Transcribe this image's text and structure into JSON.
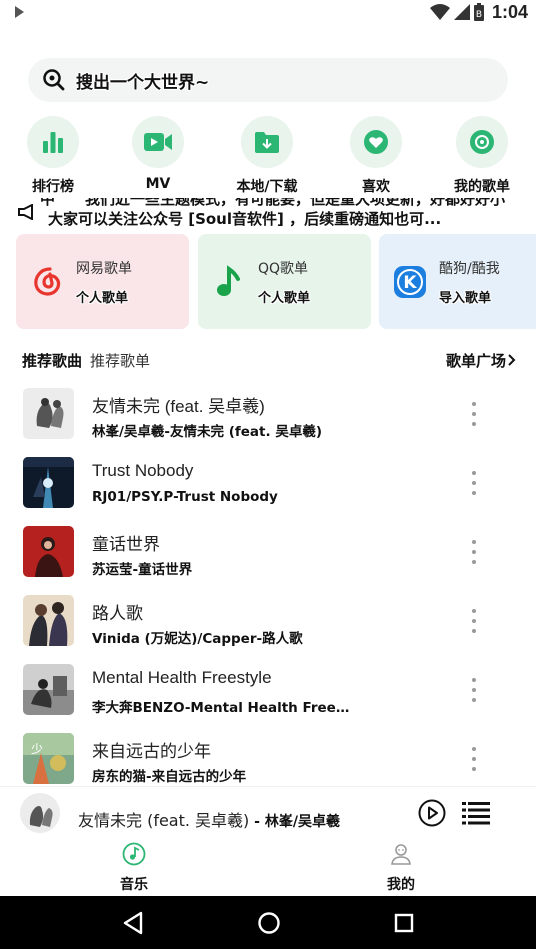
{
  "status_bar": {
    "time": "1:04"
  },
  "search": {
    "placeholder": "搜出一个大世界~"
  },
  "quick_nav": [
    {
      "label": "排行榜",
      "icon": "bar-chart-icon"
    },
    {
      "label": "MV",
      "icon": "video-icon"
    },
    {
      "label": "本地/下载",
      "icon": "download-folder-icon"
    },
    {
      "label": "喜欢",
      "icon": "heart-icon"
    },
    {
      "label": "我的歌单",
      "icon": "playlist-disc-icon"
    }
  ],
  "notice": {
    "line1": "中　　我们近一些主题模式，有可能要，但是重大项更新，好都好好小",
    "line2": "大家可以关注公众号 [Soul音软件] ，后续重磅通知也可..."
  },
  "playlist_cards": [
    {
      "title": "网易歌单",
      "subtitle": "个人歌单",
      "icon": "netease-music-icon",
      "bg": "#fae6e8"
    },
    {
      "title": "QQ歌单",
      "subtitle": "个人歌单",
      "icon": "qq-music-icon",
      "bg": "#e6f4ea"
    },
    {
      "title": "酷狗/酷我",
      "subtitle": "导入歌单",
      "icon": "kugou-icon",
      "bg": "#e6f0fa"
    }
  ],
  "section": {
    "title": "推荐歌曲",
    "subtitle": "推荐歌单",
    "more": "歌单广场"
  },
  "songs": [
    {
      "title": "友情未完 (feat. 吴卓羲)",
      "subtitle": "林峯/吴卓羲-友情未完 (feat. 吴卓羲)"
    },
    {
      "title": "Trust Nobody",
      "subtitle": "RJ01/PSY.P-Trust Nobody"
    },
    {
      "title": "童话世界",
      "subtitle": "苏运莹-童话世界"
    },
    {
      "title": "路人歌",
      "subtitle": "Vinida (万妮达)/Capper-路人歌"
    },
    {
      "title": "Mental Health Freestyle",
      "subtitle": "李大奔BENZO-Mental Health Freest..."
    },
    {
      "title": "来自远古的少年",
      "subtitle": "房东的猫-来自远古的少年"
    }
  ],
  "player": {
    "title": "友情未完 (feat. 吴卓羲)",
    "artist": " - 林峯/吴卓羲"
  },
  "tabs": [
    {
      "label": "音乐",
      "icon": "music-disc-icon",
      "active": true
    },
    {
      "label": "我的",
      "icon": "user-icon",
      "active": false
    }
  ],
  "colors": {
    "accent": "#2bb673",
    "netease": "#e8362f",
    "qq": "#1aa34a",
    "kugou": "#1c7fe0"
  }
}
